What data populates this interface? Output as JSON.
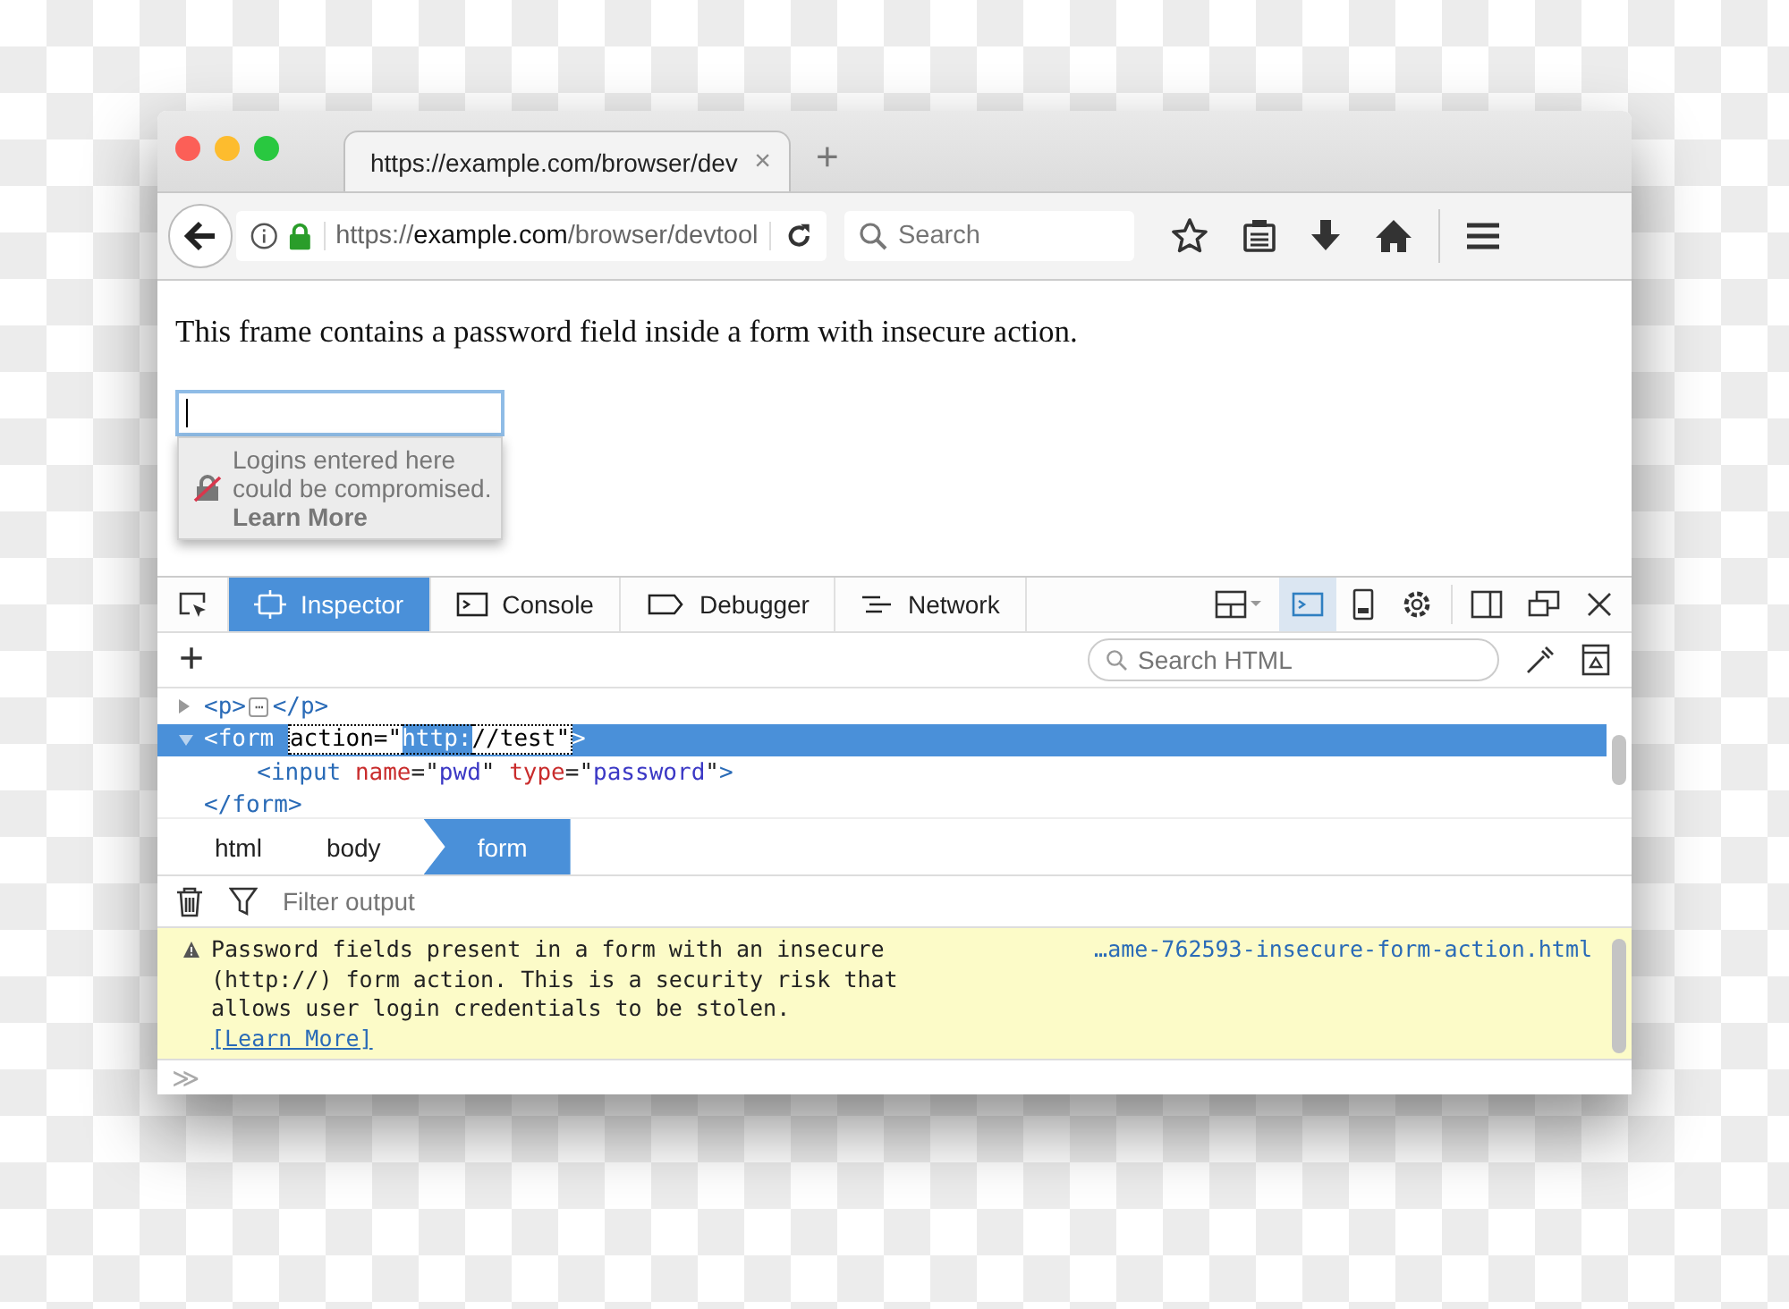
{
  "browser": {
    "tab": {
      "title": "https://example.com/browser/dev",
      "selected": true,
      "close": "×"
    },
    "new_tab": "+",
    "url": {
      "scheme": "https://",
      "host": "example.com",
      "path": "/browser/devtool"
    },
    "search": {
      "placeholder": "Search"
    }
  },
  "content": {
    "paragraph": "This frame contains a password field inside a form with insecure action.",
    "password_field": {
      "focused": true
    },
    "warning_popup": {
      "message": "Logins entered here could be compromised.",
      "link": "Learn More"
    }
  },
  "devtools": {
    "tabs": [
      {
        "label": "Inspector",
        "selected": true
      },
      {
        "label": "Console",
        "selected": false
      },
      {
        "label": "Debugger",
        "selected": false
      },
      {
        "label": "Network",
        "selected": false
      }
    ],
    "add": "+",
    "markup_search": {
      "placeholder": "Search HTML"
    },
    "markup": [
      {
        "expanded": false,
        "selected": false,
        "tokens": [
          {
            "kind": "tag",
            "text": "<p>"
          },
          {
            "kind": "badge",
            "text": "⋯"
          },
          {
            "kind": "tag",
            "text": "</p>"
          }
        ]
      },
      {
        "expanded": true,
        "selected": true,
        "tokens": [
          {
            "kind": "tag",
            "text": "<form "
          },
          {
            "kind": "attr-open",
            "text": "action=\""
          },
          {
            "kind": "sel",
            "text": "http:"
          },
          {
            "kind": "attr-close",
            "text": "//test\""
          },
          {
            "kind": "tag",
            "text": ">"
          }
        ]
      },
      {
        "selected": false,
        "tokens": [
          {
            "kind": "tag",
            "text": "  <input "
          },
          {
            "kind": "attr",
            "text": "name"
          },
          {
            "kind": "punct",
            "text": "=\""
          },
          {
            "kind": "value",
            "text": "pwd"
          },
          {
            "kind": "punct",
            "text": "\" "
          },
          {
            "kind": "attr",
            "text": "type"
          },
          {
            "kind": "punct",
            "text": "=\""
          },
          {
            "kind": "value",
            "text": "password"
          },
          {
            "kind": "punct",
            "text": "\""
          },
          {
            "kind": "tag",
            "text": ">"
          }
        ]
      },
      {
        "selected": false,
        "tokens": [
          {
            "kind": "tag",
            "text": "</form>"
          }
        ]
      }
    ],
    "breadcrumbs": [
      {
        "label": "html",
        "selected": false
      },
      {
        "label": "body",
        "selected": false
      },
      {
        "label": "form",
        "selected": true
      }
    ],
    "filter": {
      "placeholder": "Filter output"
    },
    "messages": [
      {
        "kind": "warning",
        "text": "Password fields present in a form with an insecure (http://) form action. This is a security risk that allows user login credentials to be stolen.",
        "link": "[Learn More]",
        "source": "…ame-762593-insecure-form-action.html"
      }
    ],
    "prompt": "≫"
  }
}
